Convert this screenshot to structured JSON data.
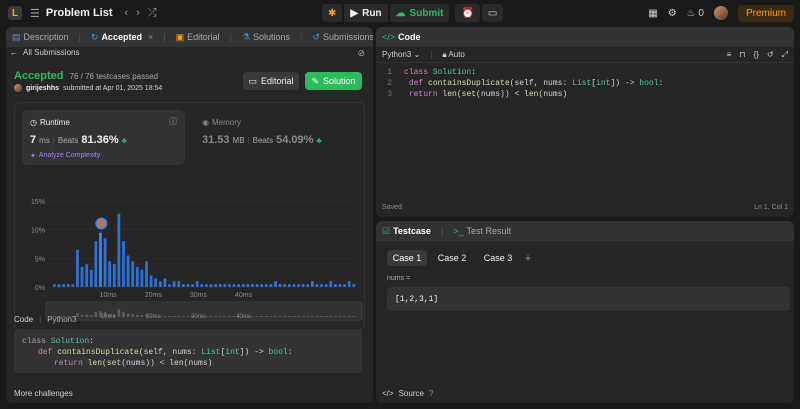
{
  "topbar": {
    "logo": "L",
    "title": "Problem List",
    "run": "Run",
    "submit": "Submit",
    "notifications": "0",
    "premium": "Premium"
  },
  "left_tabs": [
    {
      "label": "Description"
    },
    {
      "label": "Accepted",
      "close": "×"
    },
    {
      "label": "Editorial"
    },
    {
      "label": "Solutions"
    },
    {
      "label": "Submissions"
    }
  ],
  "submission": {
    "back": "All Submissions",
    "status": "Accepted",
    "testcases": "76 / 76 testcases passed",
    "user": "girijeshhs",
    "submitted": "submitted at Apr 01, 2025 18:54",
    "editorial_btn": "Editorial",
    "solution_btn": "Solution",
    "runtime": {
      "label": "Runtime",
      "value": "7",
      "unit": "ms",
      "beats_label": "Beats",
      "beats": "81.36%",
      "analyze": "Analyze Complexity"
    },
    "memory": {
      "label": "Memory",
      "value": "31.53",
      "unit": "MB",
      "beats_label": "Beats",
      "beats": "54.09%"
    },
    "code_label": "Code",
    "code_lang": "Python3",
    "more": "More challenges"
  },
  "chart_data": {
    "type": "bar",
    "yticks": [
      "15%",
      "10%",
      "5%",
      "0%"
    ],
    "xticks": [
      "10ms",
      "20ms",
      "30ms",
      "40ms"
    ],
    "ylim": [
      0,
      15
    ],
    "highlight_index": 10,
    "values": [
      0.5,
      0.5,
      0.5,
      0.5,
      0.5,
      6.5,
      3.5,
      4,
      3,
      8,
      9.5,
      8.5,
      4.5,
      4,
      12.8,
      8,
      5.5,
      4.5,
      3.5,
      3,
      4.5,
      2,
      1.5,
      1,
      1.5,
      0.5,
      1,
      1,
      0.5,
      0.5,
      0.5,
      1,
      0.5,
      0.5,
      0.5,
      0.5,
      0.5,
      0.5,
      0.5,
      0.5,
      0.5,
      0.5,
      0.5,
      0.5,
      0.5,
      0.5,
      0.5,
      0.5,
      1,
      0.5,
      0.5,
      0.5,
      0.5,
      0.5,
      0.5,
      0.5,
      1,
      0.5,
      0.5,
      0.5,
      1,
      0.5,
      0.5,
      0.5,
      1,
      0.5
    ]
  },
  "code_panel": {
    "title": "Code",
    "lang": "Python3",
    "auto": "Auto",
    "lines": [
      {
        "n": "1",
        "text": "class Solution:"
      },
      {
        "n": "2",
        "text": "    def containsDuplicate(self, nums: List[int]) -> bool:"
      },
      {
        "n": "3",
        "text": "        return len(set(nums)) < len(nums)"
      }
    ],
    "saved": "Saved",
    "position": "Ln 1, Col 1"
  },
  "test_panel": {
    "tab1": "Testcase",
    "tab2": "Test Result",
    "cases": [
      "Case 1",
      "Case 2",
      "Case 3"
    ],
    "add": "+",
    "param": "nums =",
    "value": "[1,2,3,1]",
    "source": "Source"
  },
  "colors": {
    "accent": "#2cbb5d",
    "bar": "#3b82f6",
    "orange": "#ffa116"
  }
}
